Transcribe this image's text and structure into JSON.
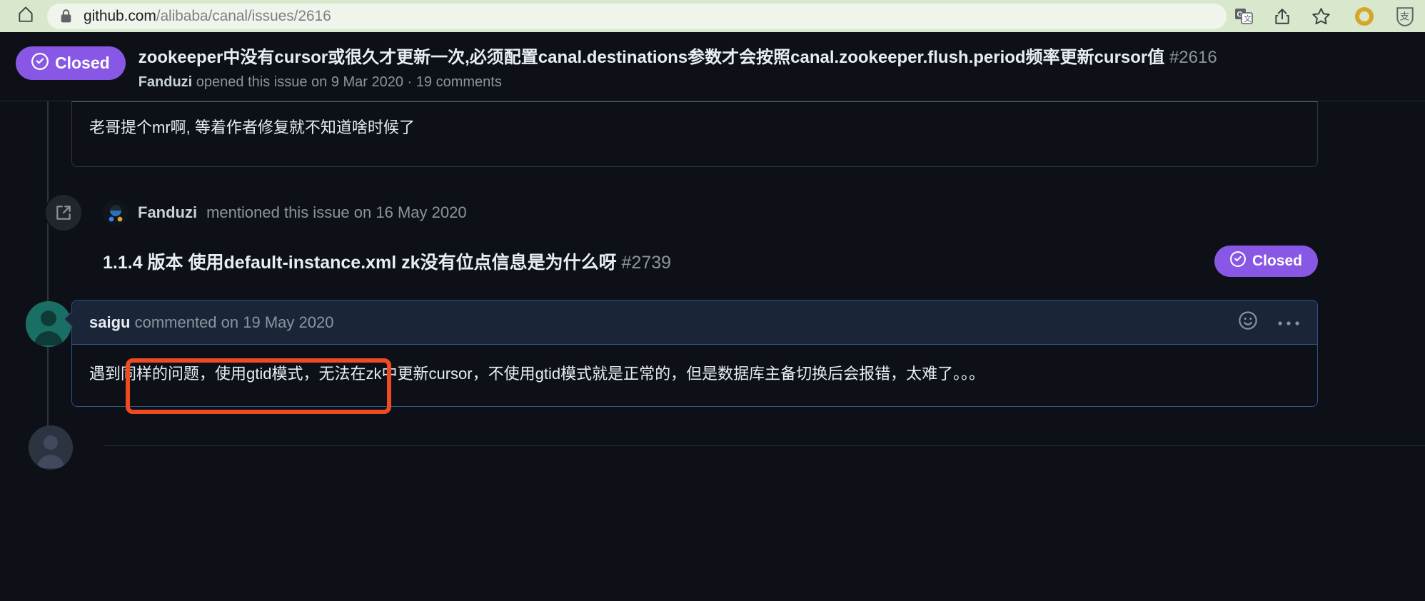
{
  "browser": {
    "home_icon": "home-icon",
    "lock_icon": "lock-icon",
    "url_host": "github.com",
    "url_path": "/alibaba/canal/issues/2616",
    "url_full": "github.com/alibaba/canal/issues/2616",
    "actions": [
      {
        "name": "translate-icon",
        "label": "Translate"
      },
      {
        "name": "share-icon",
        "label": "Share"
      },
      {
        "name": "bookmark-star-icon",
        "label": "Add bookmark"
      }
    ],
    "extensions": [
      {
        "name": "profile-avatar-icon",
        "label": "O",
        "color": "#d6a629"
      },
      {
        "name": "alipay-shield-icon",
        "label": "支"
      }
    ],
    "toolbar_bg": "#d7e8cd",
    "url_field_bg": "#eff5eb"
  },
  "issue": {
    "state": "Closed",
    "state_color": "#8957e5",
    "state_icon": "issue-closed-icon",
    "title": "zookeeper中没有cursor或很久才更新一次,必须配置canal.destinations参数才会按照canal.zookeeper.flush.period频率更新cursor值",
    "number": "#2616",
    "author": "Fanduzi",
    "meta": "opened this issue on 9 Mar 2020 · 19 comments"
  },
  "timeline": {
    "partial_comment": {
      "body": "老哥提个mr啊, 等着作者修复就不知道啥时候了"
    },
    "cross_reference": {
      "icon": "cross-reference-icon",
      "actor": "Fanduzi",
      "text": "mentioned this issue on 16 May 2020",
      "ref_title": "1.1.4 版本 使用default-instance.xml zk没有位点信息是为什么呀",
      "ref_number": "#2739",
      "ref_state": "Closed",
      "ref_state_icon": "issue-closed-icon",
      "ref_state_color": "#8957e5"
    },
    "highlighted_comment": {
      "author": "saigu",
      "meta": "commented on 19 May 2020",
      "header_full": "saigu commented on 19 May 2020",
      "reaction_icon": "smiley-reaction-icon",
      "menu_icon": "kebab-menu-icon",
      "body": "遇到同样的问题，使用gtid模式，无法在zk中更新cursor，不使用gtid模式就是正常的，但是数据库主备切换后会报错，太难了。。。",
      "border_color": "#2f5288",
      "header_bg": "#1b2538"
    }
  },
  "annotation": {
    "shape": "rectangle",
    "color": "#f04a23",
    "targets": "saigu commented on 19 May 2020"
  }
}
